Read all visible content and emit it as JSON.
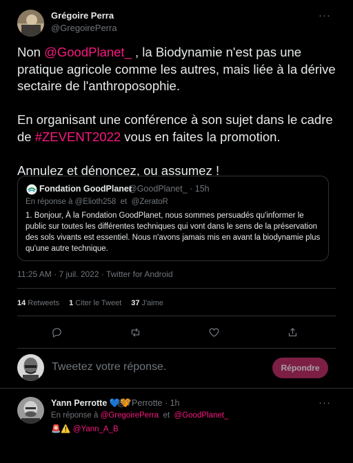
{
  "author": {
    "name": "Grégoire Perra",
    "handle": "@GregoirePerra"
  },
  "more_label": "···",
  "tweet": {
    "p1_a": "Non ",
    "p1_mention": "@GoodPlanet_",
    "p1_b": " , la Biodynamie n'est pas une pratique agricole comme les autres, mais liée à la dérive sectaire de l'anthroposophie.",
    "p2_a": "En organisant une conférence à  son sujet dans le cadre de ",
    "p2_hashtag": "#ZEVENT2022",
    "p2_b": " vous en faites la promotion.",
    "p3": "Annulez et dénoncez, ou assumez !"
  },
  "quote": {
    "name": "Fondation GoodPlanet",
    "handle": "@GoodPlanet_ · 15h",
    "reply_prefix": "En réponse à",
    "reply_to_1": "@Elioth258",
    "reply_and": "et",
    "reply_to_2": "@ZeratoR",
    "text": "1. Bonjour, À la Fondation GoodPlanet, nous sommes persuadés qu'informer le public sur toutes les différentes techniques qui vont dans le sens de la préservation des sols vivants est essentiel. Nous n'avons jamais mis en avant la biodynamie plus qu'une autre technique."
  },
  "meta": "11:25 AM · 7 juil. 2022 · Twitter for Android",
  "stats": {
    "retweets_count": "14",
    "retweets_label": "Retweets",
    "quotes_count": "1",
    "quotes_label": "Citer le Tweet",
    "likes_count": "37",
    "likes_label": "J'aime"
  },
  "actions": [
    "reply-icon",
    "retweet-icon",
    "like-icon",
    "share-icon"
  ],
  "composer": {
    "placeholder": "Tweetez votre réponse.",
    "button": "Répondre"
  },
  "reply": {
    "name": "Yann Perrotte",
    "emoji": "💙🧡",
    "handle": "@YPerrotte · 1h",
    "reply_prefix": "En réponse à",
    "reply_to_1": "@GregoirePerra",
    "reply_and": "et",
    "reply_to_2": "@GoodPlanet_",
    "emoji2": "🚨⚠️",
    "mention": "@Yann_A_B"
  },
  "colors": {
    "background": "#000000",
    "accent": "#f91880",
    "muted": "#71767b",
    "text": "#e7e9ea",
    "button": "#7d1f45"
  }
}
